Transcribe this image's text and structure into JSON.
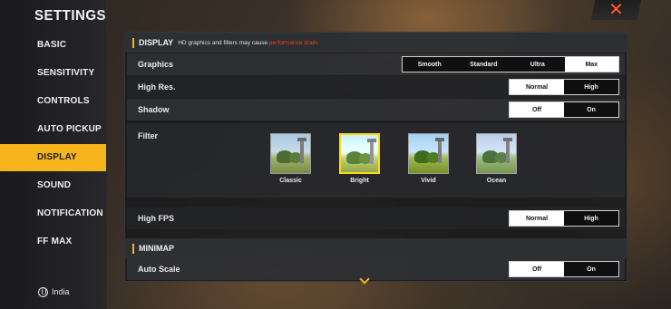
{
  "sidebar": {
    "title": "SETTINGS",
    "items": [
      {
        "label": "BASIC"
      },
      {
        "label": "SENSITIVITY"
      },
      {
        "label": "CONTROLS"
      },
      {
        "label": "AUTO PICKUP"
      },
      {
        "label": "DISPLAY",
        "active": true
      },
      {
        "label": "SOUND"
      },
      {
        "label": "NOTIFICATION"
      },
      {
        "label": "FF MAX"
      }
    ],
    "region": "India"
  },
  "close": {
    "symbol": "✕",
    "icon": "close-icon"
  },
  "display": {
    "title": "DISPLAY",
    "note": "HD graphics and filters may cause",
    "note_warn": "performance drain.",
    "graphics": {
      "label": "Graphics",
      "options": [
        "Smooth",
        "Standard",
        "Ultra",
        "Max"
      ],
      "selected": "Max"
    },
    "high_res": {
      "label": "High Res.",
      "options": [
        "Normal",
        "High"
      ],
      "selected": "Normal"
    },
    "shadow": {
      "label": "Shadow",
      "options": [
        "Off",
        "On"
      ],
      "selected": "Off"
    },
    "filter": {
      "label": "Filter",
      "options": [
        "Classic",
        "Bright",
        "Vivid",
        "Ocean"
      ],
      "selected": "Bright"
    },
    "high_fps": {
      "label": "High FPS",
      "options": [
        "Normal",
        "High"
      ],
      "selected": "Normal"
    }
  },
  "minimap": {
    "title": "MINIMAP",
    "auto_scale": {
      "label": "Auto Scale",
      "options": [
        "Off",
        "On"
      ],
      "selected": "Off"
    }
  },
  "colors": {
    "accent": "#f6b51c",
    "warning": "#ff3d2a",
    "close": "#ff5a2c"
  }
}
